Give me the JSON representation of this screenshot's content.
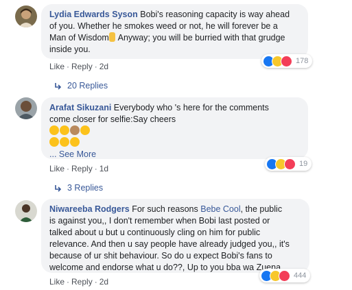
{
  "comments": [
    {
      "author": "Lydia Edwards Syson",
      "text_lines": [
        "Bobi's reasoning capacity is way ahead",
        "of you. Whether he smokes weed or not, he will forever be a",
        "Man of Wisdom",
        " Anyway; you will be burried with that grudge",
        "inside you."
      ],
      "reaction_count": "178",
      "actions": {
        "like": "Like",
        "reply": "Reply",
        "time": "2d"
      },
      "replies": "20 Replies"
    },
    {
      "author": "Arafat Sikuzani",
      "text_lines": [
        "Everybody who 's here for the comments",
        "come closer for selfie:Say cheers"
      ],
      "see_more": "... See More",
      "reaction_count": "19",
      "actions": {
        "like": "Like",
        "reply": "Reply",
        "time": "1d"
      },
      "replies": "3 Replies"
    },
    {
      "author": "Niwareeba Rodgers",
      "text_lines": [
        " For such reasons ",
        "Bebe Cool",
        ", the public",
        "is against you,, I don't remember when Bobi last posted or",
        "talked about u but u continuously cling on him for public",
        "relevance. And then u say people have already judged you,, it's",
        "because of ur shit behaviour. So do u expect Bobi's fans to",
        "welcome and endorse what u do??, Up to you bba wa Zuena"
      ],
      "reaction_count": "444",
      "actions": {
        "like": "Like",
        "reply": "Reply",
        "time": "2d"
      }
    }
  ],
  "colors": {
    "link": "#385898",
    "bubble": "#f2f3f5",
    "like": "#1877f2",
    "haha": "#f7c72b",
    "love": "#f33e58"
  },
  "icons": [
    "like-reaction-icon",
    "haha-reaction-icon",
    "love-reaction-icon",
    "reply-arrow-icon"
  ]
}
